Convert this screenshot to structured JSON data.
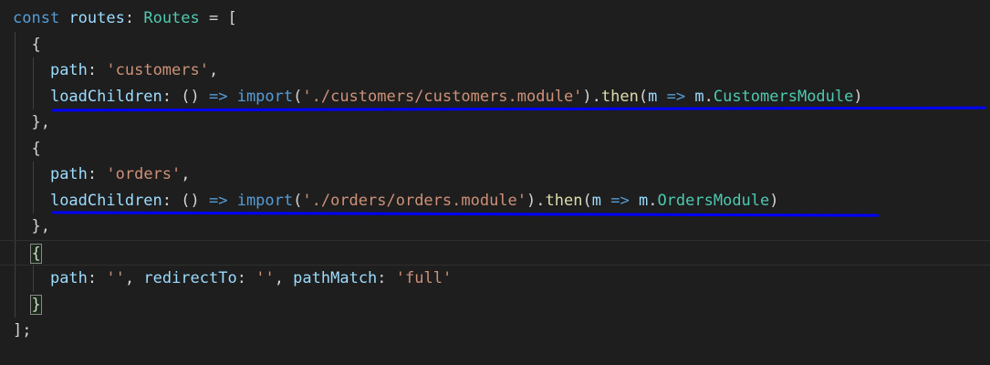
{
  "editor": {
    "lines": [
      {
        "tokens": [
          [
            "kw",
            "const"
          ],
          [
            "punc",
            " "
          ],
          [
            "id",
            "routes"
          ],
          [
            "punc",
            ": "
          ],
          [
            "type",
            "Routes"
          ],
          [
            "punc",
            " = ["
          ]
        ]
      },
      {
        "indent": 1,
        "tokens": [
          [
            "punc",
            "{"
          ]
        ]
      },
      {
        "indent": 2,
        "tokens": [
          [
            "id",
            "path"
          ],
          [
            "punc",
            ": "
          ],
          [
            "str",
            "'customers'"
          ],
          [
            "punc",
            ","
          ]
        ]
      },
      {
        "indent": 2,
        "tokens": [
          [
            "id",
            "loadChildren"
          ],
          [
            "punc",
            ": () "
          ],
          [
            "kw",
            "=>"
          ],
          [
            "punc",
            " "
          ],
          [
            "kw",
            "import"
          ],
          [
            "punc",
            "("
          ],
          [
            "str",
            "'./customers/customers.module'"
          ],
          [
            "punc",
            ")."
          ],
          [
            "fn",
            "then"
          ],
          [
            "punc",
            "("
          ],
          [
            "id",
            "m"
          ],
          [
            "punc",
            " "
          ],
          [
            "kw",
            "=>"
          ],
          [
            "punc",
            " "
          ],
          [
            "id",
            "m"
          ],
          [
            "punc",
            "."
          ],
          [
            "type",
            "CustomersModule"
          ],
          [
            "punc",
            ")"
          ]
        ]
      },
      {
        "indent": 1,
        "tokens": [
          [
            "punc",
            "},"
          ]
        ]
      },
      {
        "indent": 1,
        "tokens": [
          [
            "punc",
            "{"
          ]
        ]
      },
      {
        "indent": 2,
        "tokens": [
          [
            "id",
            "path"
          ],
          [
            "punc",
            ": "
          ],
          [
            "str",
            "'orders'"
          ],
          [
            "punc",
            ","
          ]
        ]
      },
      {
        "indent": 2,
        "tokens": [
          [
            "id",
            "loadChildren"
          ],
          [
            "punc",
            ": () "
          ],
          [
            "kw",
            "=>"
          ],
          [
            "punc",
            " "
          ],
          [
            "kw",
            "import"
          ],
          [
            "punc",
            "("
          ],
          [
            "str",
            "'./orders/orders.module'"
          ],
          [
            "punc",
            ")."
          ],
          [
            "fn",
            "then"
          ],
          [
            "punc",
            "("
          ],
          [
            "id",
            "m"
          ],
          [
            "punc",
            " "
          ],
          [
            "kw",
            "=>"
          ],
          [
            "punc",
            " "
          ],
          [
            "id",
            "m"
          ],
          [
            "punc",
            "."
          ],
          [
            "type",
            "OrdersModule"
          ],
          [
            "punc",
            ")"
          ]
        ]
      },
      {
        "indent": 1,
        "tokens": [
          [
            "punc",
            "},"
          ]
        ]
      },
      {
        "indent": 1,
        "current": true,
        "tokens": [
          [
            "bracket",
            "{"
          ]
        ]
      },
      {
        "indent": 2,
        "tokens": [
          [
            "id",
            "path"
          ],
          [
            "punc",
            ": "
          ],
          [
            "str",
            "''"
          ],
          [
            "punc",
            ", "
          ],
          [
            "id",
            "redirectTo"
          ],
          [
            "punc",
            ": "
          ],
          [
            "str",
            "''"
          ],
          [
            "punc",
            ", "
          ],
          [
            "id",
            "pathMatch"
          ],
          [
            "punc",
            ": "
          ],
          [
            "str",
            "'full'"
          ]
        ]
      },
      {
        "indent": 1,
        "tokens": [
          [
            "bracket",
            "}"
          ]
        ]
      },
      {
        "indent": 0,
        "tokens": [
          [
            "punc",
            "];"
          ]
        ]
      }
    ]
  },
  "colors": {
    "background": "#1e1e1e",
    "keyword": "#569cd6",
    "identifier": "#9cdcfe",
    "type": "#4ec9b0",
    "string": "#ce9178",
    "function": "#dcdcaa",
    "underline": "#0000ff"
  }
}
